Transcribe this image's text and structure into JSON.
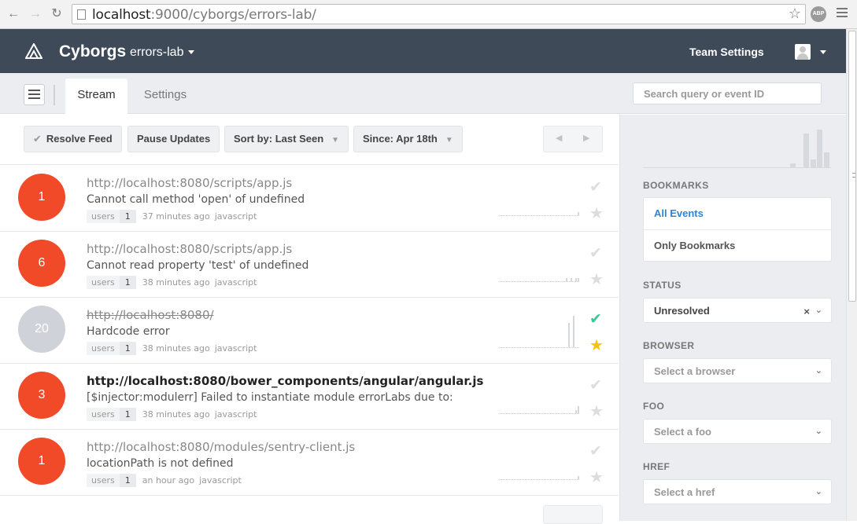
{
  "browser": {
    "url_host": "localhost",
    "url_rest": ":9000/cyborgs/errors-lab/",
    "abp_label": "ABP"
  },
  "header": {
    "brand": "Cyborgs",
    "project": "errors-lab",
    "team_settings": "Team Settings"
  },
  "tabs": [
    {
      "label": "Stream"
    },
    {
      "label": "Settings"
    }
  ],
  "search": {
    "placeholder": "Search query or event ID"
  },
  "toolbar": {
    "resolve": "Resolve Feed",
    "pause": "Pause Updates",
    "sort": "Sort by: Last Seen",
    "since": "Since: Apr 18th"
  },
  "events": [
    {
      "count": "1",
      "title": "http://localhost:8080/scripts/app.js",
      "message": "Cannot call method 'open' of undefined",
      "users_label": "users",
      "users": "1",
      "time": "37 minutes ago",
      "platform": "javascript",
      "resolved": false,
      "bookmarked": false,
      "spark": [
        0,
        0,
        0,
        0,
        0,
        0,
        0,
        0,
        0,
        0,
        0,
        0,
        0,
        0,
        0,
        0,
        0,
        0,
        0,
        0,
        0,
        0,
        0,
        0,
        0,
        0,
        0,
        0,
        0,
        0,
        0,
        0,
        0,
        1
      ]
    },
    {
      "count": "6",
      "title": "http://localhost:8080/scripts/app.js",
      "message": "Cannot read property 'test' of undefined",
      "users_label": "users",
      "users": "1",
      "time": "38 minutes ago",
      "platform": "javascript",
      "resolved": false,
      "bookmarked": false,
      "spark": [
        0,
        0,
        0,
        0,
        0,
        0,
        0,
        0,
        0,
        0,
        0,
        0,
        0,
        0,
        0,
        0,
        0,
        0,
        0,
        0,
        0,
        0,
        0,
        0,
        0,
        0,
        0,
        0,
        1,
        0,
        1,
        0,
        1,
        1
      ]
    },
    {
      "count": "20",
      "title": "http://localhost:8080/",
      "message": "Hardcode error",
      "users_label": "users",
      "users": "1",
      "time": "38 minutes ago",
      "platform": "javascript",
      "resolved": true,
      "bookmarked": true,
      "spark": [
        0,
        0,
        0,
        0,
        0,
        0,
        0,
        0,
        0,
        0,
        0,
        0,
        0,
        0,
        0,
        0,
        0,
        0,
        0,
        0,
        0,
        0,
        0,
        0,
        0,
        0,
        0,
        0,
        0,
        7,
        0,
        9,
        0,
        0
      ]
    },
    {
      "count": "3",
      "title": "http://localhost:8080/bower_components/angular/angular.js",
      "message": "[$injector:modulerr] Failed to instantiate module errorLabs due to:",
      "users_label": "users",
      "users": "1",
      "time": "38 minutes ago",
      "platform": "javascript",
      "resolved": false,
      "bookmarked": false,
      "spark": [
        0,
        0,
        0,
        0,
        0,
        0,
        0,
        0,
        0,
        0,
        0,
        0,
        0,
        0,
        0,
        0,
        0,
        0,
        0,
        0,
        0,
        0,
        0,
        0,
        0,
        0,
        0,
        0,
        0,
        0,
        0,
        0,
        1,
        2
      ]
    },
    {
      "count": "1",
      "title": "http://localhost:8080/modules/sentry-client.js",
      "message": "locationPath is not defined",
      "users_label": "users",
      "users": "1",
      "time": "an hour ago",
      "platform": "javascript",
      "resolved": false,
      "bookmarked": false,
      "spark": [
        0,
        0,
        0,
        0,
        0,
        0,
        0,
        0,
        0,
        0,
        0,
        0,
        0,
        0,
        0,
        0,
        0,
        0,
        0,
        0,
        0,
        0,
        0,
        0,
        0,
        0,
        0,
        0,
        0,
        0,
        0,
        0,
        0,
        1
      ]
    }
  ],
  "sidebar": {
    "chart": [
      0,
      0,
      0,
      0,
      0,
      0,
      0,
      0,
      0,
      0,
      0,
      0,
      0,
      0,
      0,
      0,
      0,
      0,
      0,
      0,
      0,
      0,
      1,
      0,
      9,
      2,
      10,
      4
    ],
    "bookmarks_title": "BOOKMARKS",
    "all_events": "All Events",
    "only_bookmarks": "Only Bookmarks",
    "status_title": "STATUS",
    "status_value": "Unresolved",
    "browser_title": "BROWSER",
    "browser_placeholder": "Select a browser",
    "foo_title": "FOO",
    "foo_placeholder": "Select a foo",
    "href_title": "HREF",
    "href_placeholder": "Select a href"
  },
  "colors": {
    "header_bg": "#3f4a59",
    "count_red": "#f14a29",
    "count_grey": "#cfd3d9",
    "resolved_green": "#3cc79b",
    "bookmark_yellow": "#f6c20f",
    "active_link": "#2f84d4"
  }
}
